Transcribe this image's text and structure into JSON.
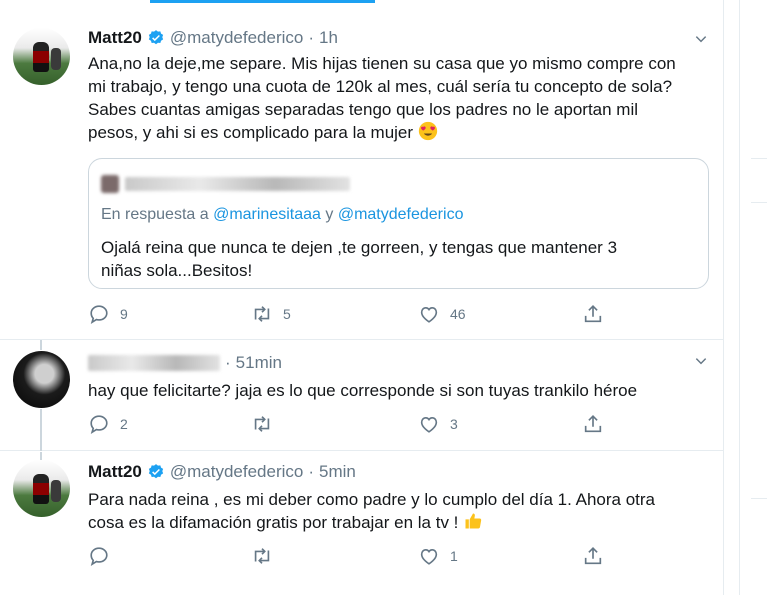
{
  "tweets": [
    {
      "name": "Matt20",
      "handle": "@matydefederico",
      "dot": "·",
      "time": "1h",
      "text": "Ana,no la deje,me separe. Mis hijas tienen su casa que yo mismo compre con\nmi trabajo, y tengo una cuota de 120k al mes, cuál sería tu concepto de sola?\nSabes cuantas amigas separadas tengo que los padres no le aportan mil\npesos, y ahi si es complicado para la mujer",
      "quoted": {
        "reply_prefix": "En respuesta a",
        "mention1": "@marinesitaaa",
        "conjunction": "y",
        "mention2": "@matydefederico",
        "text": "Ojalá reina que nunca te dejen ,te gorreen, y tengas que mantener 3\nniñas sola...Besitos!"
      },
      "counts": {
        "reply": "9",
        "retweet": "5",
        "like": "46"
      }
    },
    {
      "dot": "·",
      "time": "51min",
      "text": "hay que felicitarte? jaja es lo que corresponde si son tuyas trankilo héroe",
      "counts": {
        "reply": "2",
        "retweet": "",
        "like": "3"
      }
    },
    {
      "name": "Matt20",
      "handle": "@matydefederico",
      "dot": "·",
      "time": "5min",
      "text": "Para nada reina , es mi deber como padre y lo cumplo del día 1. Ahora otra\ncosa es la difamación gratis por trabajar en la tv !",
      "counts": {
        "reply": "",
        "retweet": "",
        "like": "1"
      }
    }
  ],
  "icons": {
    "verified": "verified-badge-icon",
    "reply": "reply-icon",
    "retweet": "retweet-icon",
    "like": "like-icon",
    "share": "share-icon",
    "chevron": "chevron-down-icon",
    "emoji1": "heart-eyes-emoji-icon",
    "emoji2": "thumbs-up-emoji-icon"
  },
  "colors": {
    "accent": "#1da1f2",
    "link": "#1b95e0",
    "muted": "#657786",
    "border": "#e6ecf0"
  }
}
